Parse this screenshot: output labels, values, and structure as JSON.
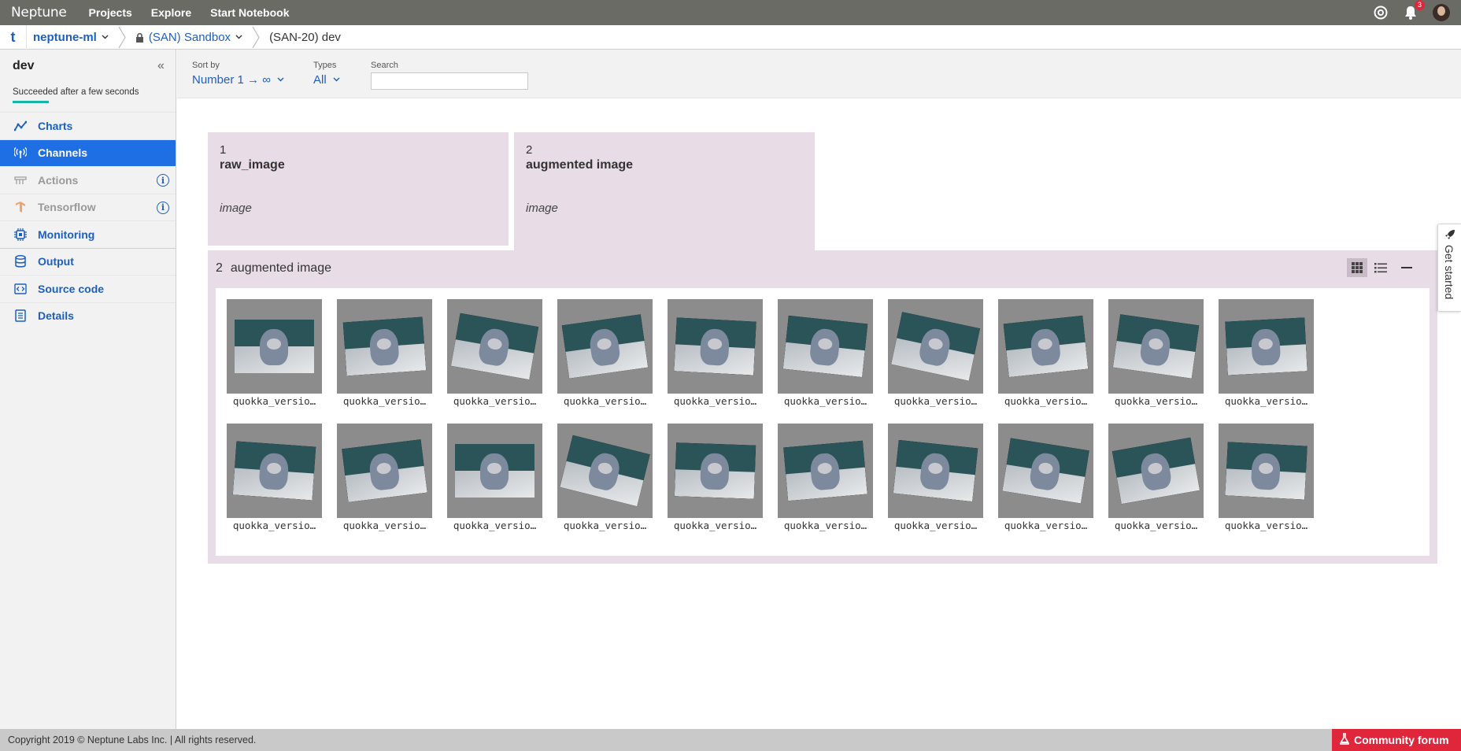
{
  "topbar": {
    "logo": "Neptune",
    "nav": [
      "Projects",
      "Explore",
      "Start Notebook"
    ],
    "notifications_count": "3"
  },
  "breadcrumb": {
    "home_icon": "t",
    "organization": "neptune-ml",
    "project": "(SAN) Sandbox",
    "experiment": "(SAN-20) dev"
  },
  "sidebar": {
    "title": "dev",
    "status": "Succeeded after a few seconds",
    "items": [
      {
        "label": "Charts",
        "icon": "chart-icon",
        "state": "normal"
      },
      {
        "label": "Channels",
        "icon": "antenna-icon",
        "state": "active"
      },
      {
        "label": "Actions",
        "icon": "actions-icon",
        "state": "disabled"
      },
      {
        "label": "Tensorflow",
        "icon": "tensorflow-icon",
        "state": "disabled"
      },
      {
        "label": "Monitoring",
        "icon": "cpu-icon",
        "state": "normal"
      },
      {
        "label": "Output",
        "icon": "database-icon",
        "state": "normal"
      },
      {
        "label": "Source code",
        "icon": "code-icon",
        "state": "normal"
      },
      {
        "label": "Details",
        "icon": "document-icon",
        "state": "normal"
      }
    ]
  },
  "toolbar": {
    "sort_label": "Sort by",
    "sort_value": "Number 1 → ∞",
    "types_label": "Types",
    "types_value": "All",
    "search_label": "Search",
    "search_value": ""
  },
  "channels": [
    {
      "number": "1",
      "name": "raw_image",
      "type": "image"
    },
    {
      "number": "2",
      "name": "augmented image",
      "type": "image"
    }
  ],
  "panel": {
    "number": "2",
    "title": "augmented image",
    "images": [
      "quokka_versio…",
      "quokka_versio…",
      "quokka_versio…",
      "quokka_versio…",
      "quokka_versio…",
      "quokka_versio…",
      "quokka_versio…",
      "quokka_versio…",
      "quokka_versio…",
      "quokka_versio…",
      "quokka_versio…",
      "quokka_versio…",
      "quokka_versio…",
      "quokka_versio…",
      "quokka_versio…",
      "quokka_versio…",
      "quokka_versio…",
      "quokka_versio…",
      "quokka_versio…",
      "quokka_versio…"
    ]
  },
  "get_started": "Get started",
  "footer": {
    "copyright": "Copyright 2019 © Neptune Labs Inc. | All rights reserved.",
    "community": "Community forum"
  },
  "colors": {
    "accent": "#1f6fe4",
    "topbar": "#6b6b66",
    "card_bg": "#e8dce7",
    "status_bar": "#17b5a6",
    "community": "#e0263b"
  }
}
